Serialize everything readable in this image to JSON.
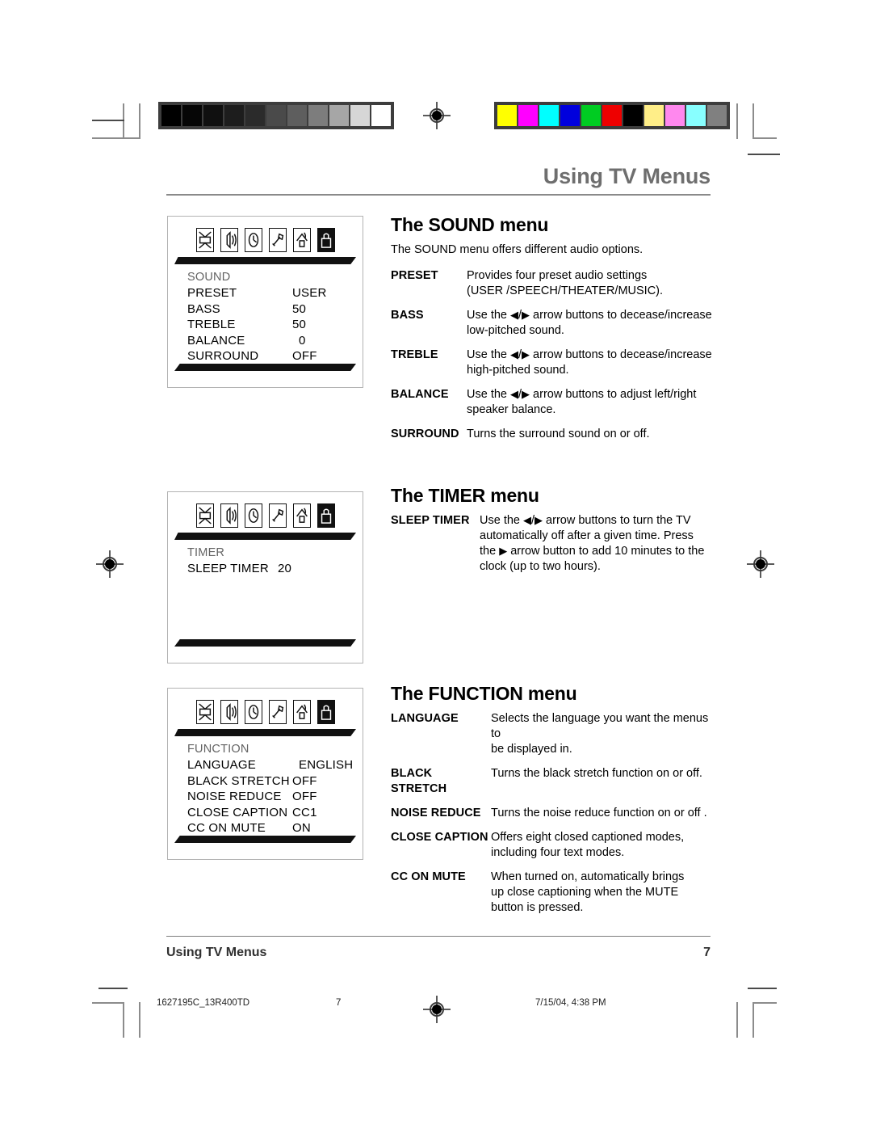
{
  "page": {
    "header_title": "Using TV Menus",
    "footer_title": "Using TV Menus",
    "footer_page_number": "7"
  },
  "print_info": {
    "doc_id": "1627195C_13R400TD",
    "sheet_number": "7",
    "timestamp": "7/15/04, 4:38 PM"
  },
  "calibration": {
    "grayscale": [
      "#000000",
      "#060606",
      "#101010",
      "#1d1d1d",
      "#2b2b2b",
      "#4a4a4a",
      "#5e5e5e",
      "#7d7d7d",
      "#a6a6a6",
      "#d6d6d6",
      "#ffffff"
    ],
    "colors": [
      "#ffff00",
      "#ff00ff",
      "#00ffff",
      "#0000dd",
      "#00cc22",
      "#ee0000",
      "#000000",
      "#ffee88",
      "#ff88ee",
      "#88ffff",
      "#808080"
    ]
  },
  "icon_strip": [
    {
      "name": "picture-tv-icon",
      "selected": false
    },
    {
      "name": "sound-speaker-icon",
      "selected": false
    },
    {
      "name": "timer-clock-icon",
      "selected": false
    },
    {
      "name": "setup-wrench-icon",
      "selected": false
    },
    {
      "name": "channel-antenna-icon",
      "selected": false
    },
    {
      "name": "function-lock-icon",
      "selected": true
    }
  ],
  "sound": {
    "osd": {
      "title": "SOUND",
      "rows": [
        {
          "label": "PRESET",
          "value": "USER"
        },
        {
          "label": "BASS",
          "value": "50"
        },
        {
          "label": "TREBLE",
          "value": "50"
        },
        {
          "label": "BALANCE",
          "value": "0"
        },
        {
          "label": "SURROUND",
          "value": "OFF"
        }
      ]
    },
    "heading": "The SOUND menu",
    "intro": "The SOUND menu offers different audio options.",
    "items": [
      {
        "term": "PRESET",
        "def_line1": "Provides four preset audio settings",
        "def_line2": "(USER /SPEECH/THEATER/MUSIC)."
      },
      {
        "term": "BASS",
        "def_pre": "Use the ",
        "def_post": " arrow buttons to decease/increase",
        "def_line2": "low-pitched sound."
      },
      {
        "term": "TREBLE",
        "def_pre": "Use the ",
        "def_post": " arrow buttons to decease/increase",
        "def_line2": "high-pitched sound."
      },
      {
        "term": "BALANCE",
        "def_pre": "Use the ",
        "def_post": " arrow buttons to adjust left/right",
        "def_line2": "speaker balance."
      },
      {
        "term": "SURROUND",
        "def_line1": "Turns the surround sound on or off.",
        "def_line2": ""
      }
    ]
  },
  "timer": {
    "osd": {
      "title": "TIMER",
      "rows": [
        {
          "label": "SLEEP TIMER",
          "value": "20"
        }
      ]
    },
    "heading": "The TIMER menu",
    "item": {
      "term": "SLEEP TIMER",
      "def_pre": "Use the ",
      "def_post": " arrow buttons to turn the TV",
      "def_line2": "automatically off after a given time. Press",
      "def_line3_pre": "the ",
      "def_line3_post": " arrow button to add 10 minutes to the",
      "def_line4": "clock (up to two hours)."
    }
  },
  "function": {
    "osd": {
      "title": "FUNCTION",
      "rows": [
        {
          "label": "LANGUAGE",
          "value": "ENGLISH"
        },
        {
          "label": "BLACK STRETCH",
          "value": "OFF"
        },
        {
          "label": "NOISE REDUCE",
          "value": "OFF"
        },
        {
          "label": "CLOSE CAPTION",
          "value": "CC1"
        },
        {
          "label": "CC ON MUTE",
          "value": "ON"
        }
      ]
    },
    "heading": "The FUNCTION menu",
    "items": [
      {
        "term": "LANGUAGE",
        "def_line1": "Selects the language you want the menus to",
        "def_line2": "be displayed in."
      },
      {
        "term": "BLACK STRETCH",
        "def_line1": "Turns the black stretch function on or off.",
        "def_line2": ""
      },
      {
        "term": "NOISE REDUCE",
        "def_line1": "Turns the noise reduce function on or off .",
        "def_line2": ""
      },
      {
        "term": "CLOSE CAPTION",
        "def_line1": "Offers eight closed captioned modes,",
        "def_line2": "including four text modes."
      },
      {
        "term": "CC ON MUTE",
        "def_line1": "When turned on, automatically brings",
        "def_line2": "up close captioning when the MUTE",
        "def_line3": "button is pressed."
      }
    ]
  },
  "glyphs": {
    "arrow_left": "◀",
    "arrow_right": "▶",
    "slash": "/"
  }
}
